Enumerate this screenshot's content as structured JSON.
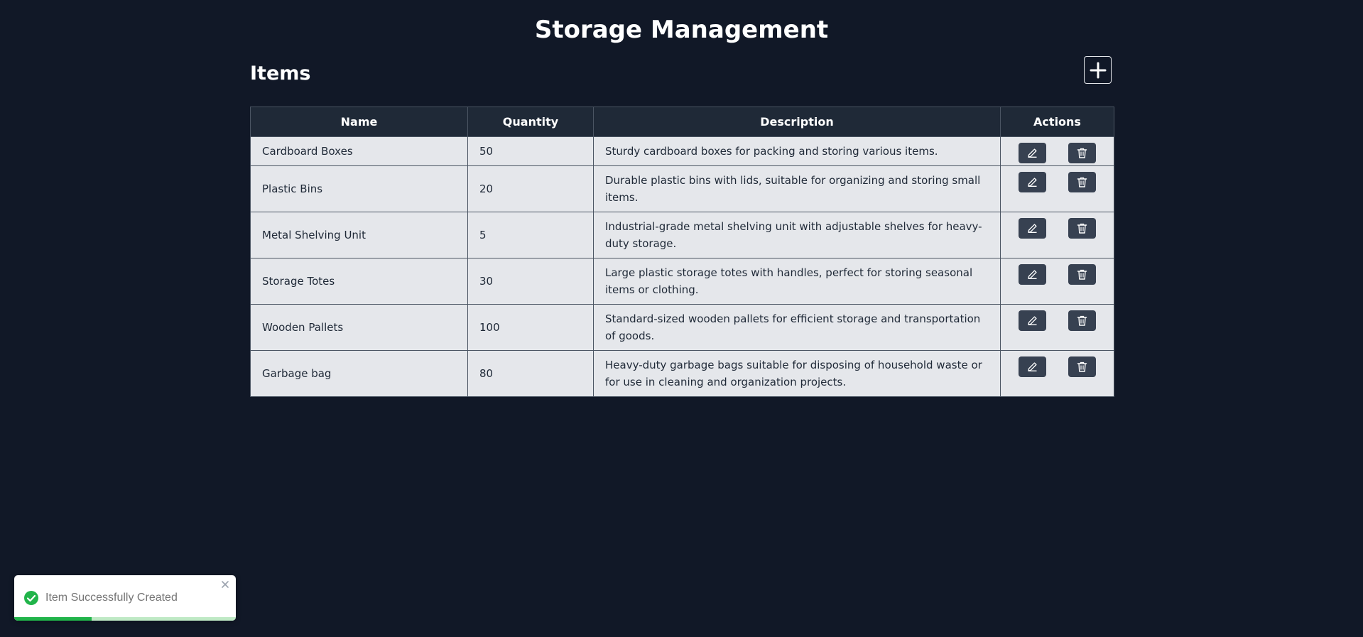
{
  "header": {
    "title": "Storage Management"
  },
  "section": {
    "title": "Items",
    "add_icon": "plus-icon"
  },
  "table": {
    "columns": [
      "Name",
      "Quantity",
      "Description",
      "Actions"
    ],
    "rows": [
      {
        "name": "Cardboard Boxes",
        "quantity": "50",
        "description": "Sturdy cardboard boxes for packing and storing various items."
      },
      {
        "name": "Plastic Bins",
        "quantity": "20",
        "description": "Durable plastic bins with lids, suitable for organizing and storing small items."
      },
      {
        "name": "Metal Shelving Unit",
        "quantity": "5",
        "description": "Industrial-grade metal shelving unit with adjustable shelves for heavy-duty storage."
      },
      {
        "name": "Storage Totes",
        "quantity": "30",
        "description": "Large plastic storage totes with handles, perfect for storing seasonal items or clothing."
      },
      {
        "name": "Wooden Pallets",
        "quantity": "100",
        "description": "Standard-sized wooden pallets for efficient storage and transportation of goods."
      },
      {
        "name": "Garbage bag",
        "quantity": "80",
        "description": "Heavy-duty garbage bags suitable for disposing of household waste or for use in cleaning and organization projects."
      }
    ],
    "action_icons": {
      "edit": "pencil-icon",
      "delete": "trash-icon"
    }
  },
  "toast": {
    "message": "Item Successfully Created",
    "icon": "check-circle-icon",
    "close_icon": "close-icon",
    "progress": 0.35
  },
  "colors": {
    "background": "#111827",
    "header_row": "#1f2937",
    "row_bg": "#e5e7eb",
    "button": "#374151",
    "success": "#21b44a"
  }
}
